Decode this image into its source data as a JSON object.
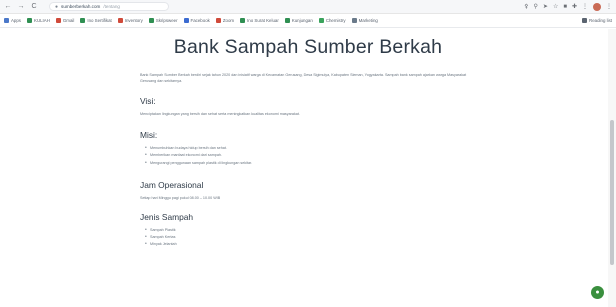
{
  "browser": {
    "back_icon": "←",
    "forward_icon": "→",
    "reload_icon": "C",
    "url_host": "sumberberkah.com",
    "url_path": "/tentang",
    "lock_icon": "●"
  },
  "bookmarks": {
    "items": [
      {
        "label": "Apps",
        "color": "#4b78c9"
      },
      {
        "label": "KULIAH",
        "color": "#2f8f52"
      },
      {
        "label": "Gmail",
        "color": "#d04a3a"
      },
      {
        "label": "Ino Sertifikat",
        "color": "#2f8f52"
      },
      {
        "label": "Inventory",
        "color": "#d04a3a"
      },
      {
        "label": "Skripsweer",
        "color": "#2f8f52"
      },
      {
        "label": "Facebook",
        "color": "#3b6bd1"
      },
      {
        "label": "Zoom",
        "color": "#d04a3a"
      },
      {
        "label": "Ino Surat Keluar",
        "color": "#2f8f52"
      },
      {
        "label": "Kunjungan",
        "color": "#2f8f52"
      },
      {
        "label": "Chemistry",
        "color": "#3aa35c"
      },
      {
        "label": "Marketing",
        "color": "#6a7a8a"
      }
    ],
    "reading_list": "Reading list"
  },
  "page": {
    "title": "Bank Sampah Sumber Berkah",
    "intro": "Bank Sampah Sumber Berkah berdiri sejak tahun 2020 dan inisiatif warga di Kecamatan Gerusang, Desa Sigimulya, Kabupaten Sleman, Yogyakarta. Sampah bank sampah ajarkan warga Masyarakat Gerusang dan sekitarnya.",
    "visi_heading": "Visi:",
    "visi_text": "Menciptakan lingkungan yang bersih dan sehat serta meningkatkan kualitas ekonomi masyarakat.",
    "misi_heading": "Misi:",
    "misi_items": [
      "Menumbuhkan budaya hidup bersih dan sehat.",
      "Memberikan manfaat ekonomi dari sampah.",
      "Mengurangi penggunaan sampah plastik di lingkungan sekitar."
    ],
    "jam_heading": "Jam Operasional",
    "jam_text": "Setiap hari Minggu pagi pukul 08.00 – 10.00 WIB",
    "jenis_heading": "Jenis Sampah",
    "jenis_items": [
      "Sampah Plastik",
      "Sampah Kertas",
      "Minyak Jelantah"
    ]
  },
  "colors": {
    "heading": "#2f3b48",
    "body_text": "#6a7580",
    "fab": "#3a8f3e"
  },
  "fab_icon": "chat-icon"
}
